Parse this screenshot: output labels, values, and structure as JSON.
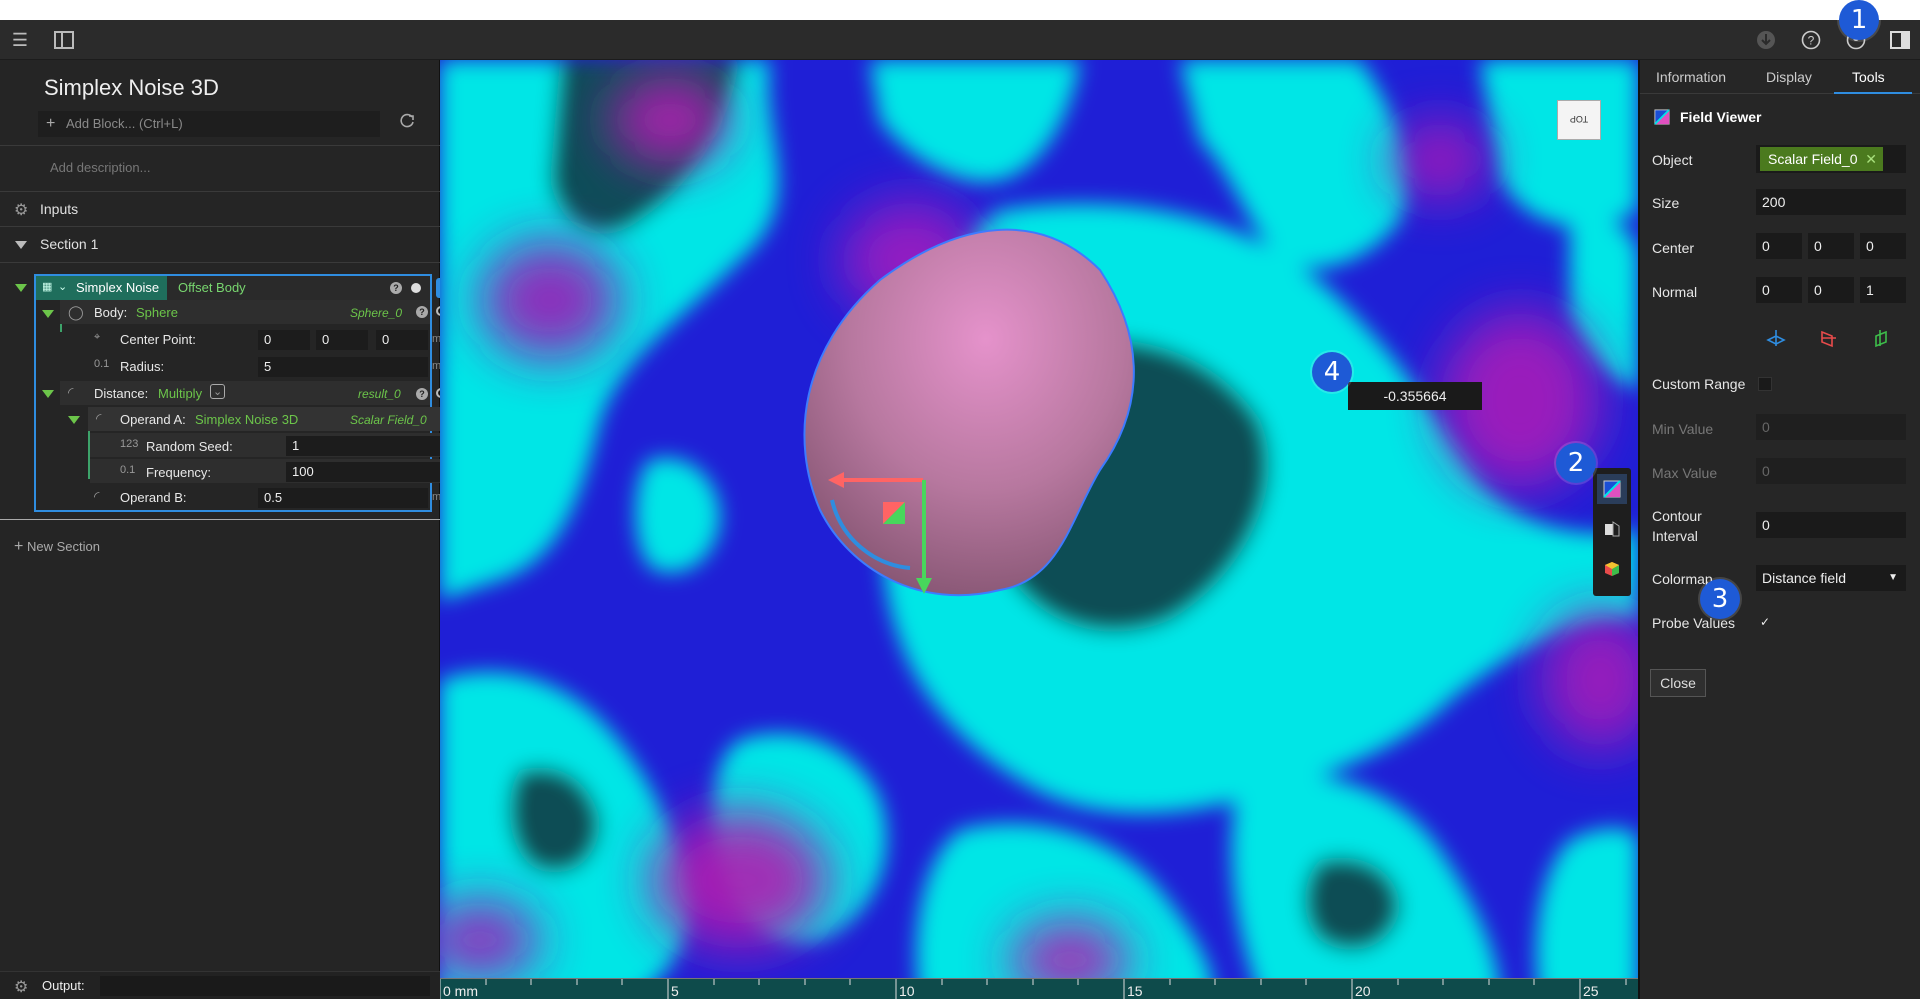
{
  "app": {
    "document_title": "Simplex Noise 3D",
    "add_block_label": "Add Block... (Ctrl+L)",
    "add_description": "Add description...",
    "inputs_label": "Inputs",
    "section_label": "Section 1",
    "new_section_label": "New Section",
    "output_label": "Output:"
  },
  "block": {
    "name": "Simplex Noise",
    "type": "Offset Body",
    "body": {
      "label": "Body:",
      "value": "Sphere",
      "result": "Sphere_0"
    },
    "center_point": {
      "label": "Center Point:",
      "x": "0",
      "y": "0",
      "z": "0",
      "unit": "mm"
    },
    "radius": {
      "label": "Radius:",
      "value": "5",
      "unit": "mm"
    },
    "distance": {
      "label": "Distance:",
      "value": "Multiply",
      "result": "result_0"
    },
    "operand_a": {
      "label": "Operand A:",
      "value": "Simplex Noise 3D",
      "result": "Scalar Field_0"
    },
    "random_seed": {
      "label": "Random Seed:",
      "value": "1"
    },
    "frequency": {
      "label": "Frequency:",
      "value": "100"
    },
    "operand_b": {
      "label": "Operand B:",
      "value": "0.5",
      "unit": "mm"
    }
  },
  "right_panel": {
    "tabs": [
      "Information",
      "Display",
      "Tools"
    ],
    "active_tab": "Tools",
    "tool_title": "Field Viewer",
    "object_label": "Object",
    "object_value": "Scalar Field_0",
    "size_label": "Size",
    "size_value": "200",
    "center_label": "Center",
    "center": [
      "0",
      "0",
      "0"
    ],
    "normal_label": "Normal",
    "normal": [
      "0",
      "0",
      "1"
    ],
    "custom_range_label": "Custom Range",
    "min_label": "Min Value",
    "min_value": "0",
    "max_label": "Max Value",
    "max_value": "0",
    "contour_label_1": "Contour",
    "contour_label_2": "Interval",
    "contour_value": "0",
    "colormap_label": "Colormap",
    "colormap_value": "Distance field",
    "probe_label": "Probe Values",
    "probe_checked": "✓",
    "close_label": "Close"
  },
  "viewport": {
    "probe_value": "-0.355664",
    "view_cube_label": "TOP",
    "ruler_ticks": [
      "0 mm",
      "5",
      "10",
      "15",
      "20",
      "25"
    ]
  },
  "badges": [
    "1",
    "2",
    "3",
    "4"
  ],
  "colors": {
    "accent": "#2f8de0",
    "green": "#6cc54a",
    "noise_low": "#1a1ad8",
    "noise_mid": "#00eaea",
    "noise_high": "#b01ab0",
    "sphere": "#c07ba8"
  }
}
